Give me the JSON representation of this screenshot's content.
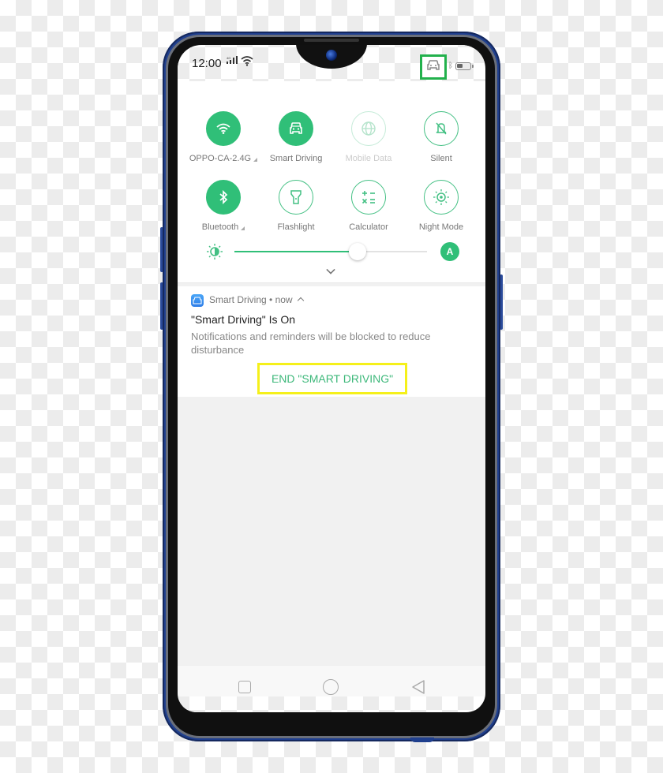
{
  "status_bar": {
    "time": "12:00",
    "network_type": "4G",
    "icons": [
      "signal-icon",
      "wifi-icon",
      "smart-driving-car-icon",
      "bluetooth-icon",
      "battery-icon"
    ]
  },
  "quick_settings": {
    "tiles": [
      {
        "label": "OPPO-CA-2.4G",
        "icon": "wifi-icon",
        "state": "on",
        "has_expand": true
      },
      {
        "label": "Smart Driving",
        "icon": "car-icon",
        "state": "on",
        "has_expand": false
      },
      {
        "label": "Mobile Data",
        "icon": "globe-icon",
        "state": "disabled",
        "has_expand": false
      },
      {
        "label": "Silent",
        "icon": "bell-off-icon",
        "state": "off",
        "has_expand": false
      },
      {
        "label": "Bluetooth",
        "icon": "bluetooth-icon",
        "state": "on",
        "has_expand": true
      },
      {
        "label": "Flashlight",
        "icon": "flashlight-icon",
        "state": "off",
        "has_expand": false
      },
      {
        "label": "Calculator",
        "icon": "calculator-icon",
        "state": "off",
        "has_expand": false
      },
      {
        "label": "Night Mode",
        "icon": "night-mode-icon",
        "state": "off",
        "has_expand": false
      }
    ],
    "brightness": {
      "level_percent": 64,
      "auto_label": "A"
    }
  },
  "notification": {
    "app_name": "Smart Driving",
    "separator": "•",
    "time": "now",
    "title": "\"Smart Driving\" Is On",
    "body": "Notifications and reminders will be blocked to reduce disturbance",
    "action_label": "END \"SMART DRIVING\""
  },
  "nav_bar": {
    "buttons": [
      "recents",
      "home",
      "back"
    ]
  },
  "colors": {
    "accent": "#30bf78",
    "highlight_status": "#22b14c",
    "highlight_action": "#f5f01a",
    "phone_frame": "#1f3f8e"
  }
}
